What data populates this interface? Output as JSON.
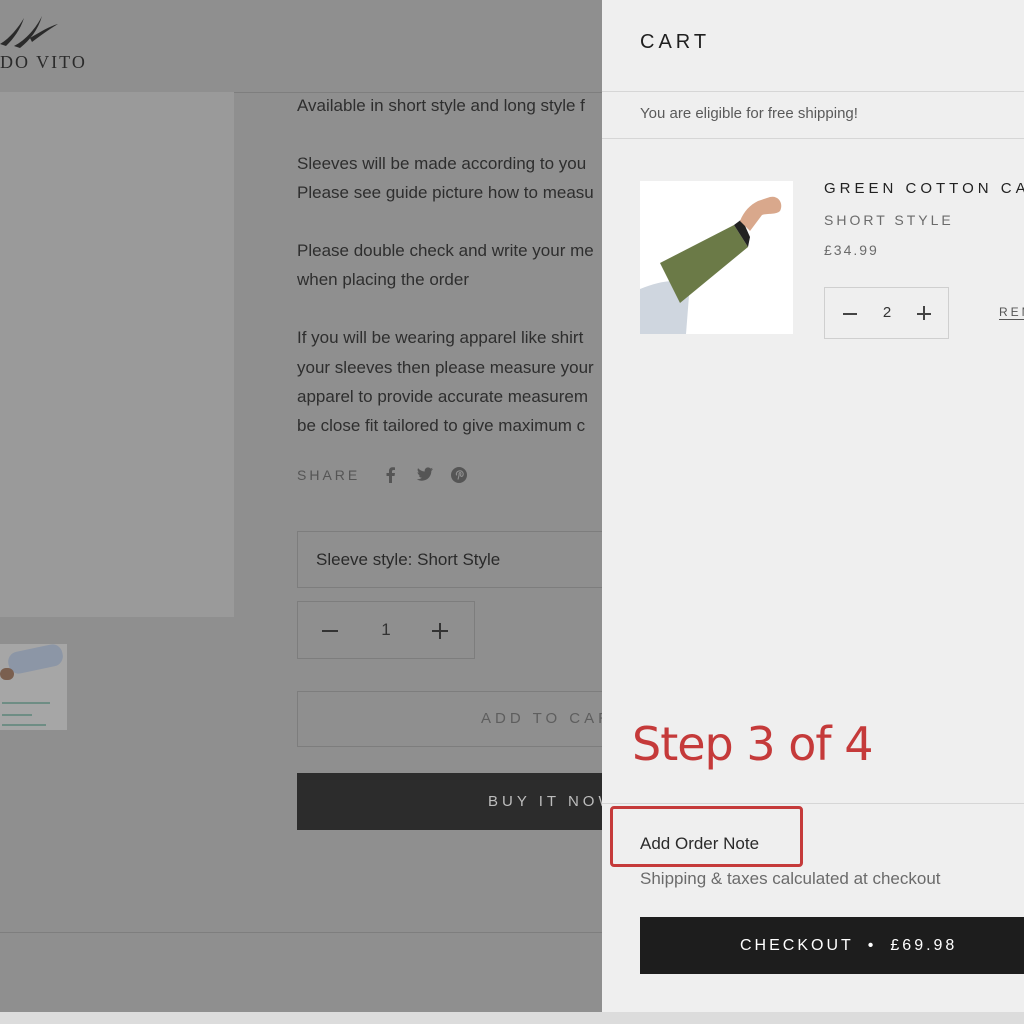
{
  "store": {
    "logo_text": "DO VITO"
  },
  "product": {
    "description": [
      "Available in short style and long style f",
      "Sleeves will be made according to you",
      "Please see guide picture how to measu",
      "Please double check and write your me",
      "when placing the order",
      "If you will be wearing apparel like shirt",
      "your sleeves then please measure your",
      "apparel to provide accurate measurem",
      "be close fit tailored to give maximum c"
    ],
    "share_label": "SHARE",
    "share_icons": [
      "facebook-icon",
      "twitter-icon",
      "pinterest-icon"
    ],
    "variant_label": "Sleeve style: Short Style",
    "quantity": "1",
    "add_to_cart_label": "ADD TO CAR",
    "buy_now_label": "BUY IT NOW"
  },
  "cart": {
    "title": "CART",
    "free_shipping": "You are eligible for free shipping!",
    "item": {
      "name": "GREEN COTTON CA",
      "style": "SHORT STYLE",
      "price": "£34.99",
      "quantity": "2",
      "remove_label": "REM"
    },
    "step_label": "Step 3 of 4",
    "order_note_label": "Add Order Note",
    "shipping_note": "Shipping & taxes calculated at checkout",
    "checkout_label": "CHECKOUT",
    "checkout_total": "£69.98",
    "checkout_separator": "•"
  },
  "colors": {
    "overlay": "#8f8f8f",
    "cart_bg": "#efefef",
    "annotation": "#c53a3a",
    "checkout_bg": "#1d1d1d"
  }
}
